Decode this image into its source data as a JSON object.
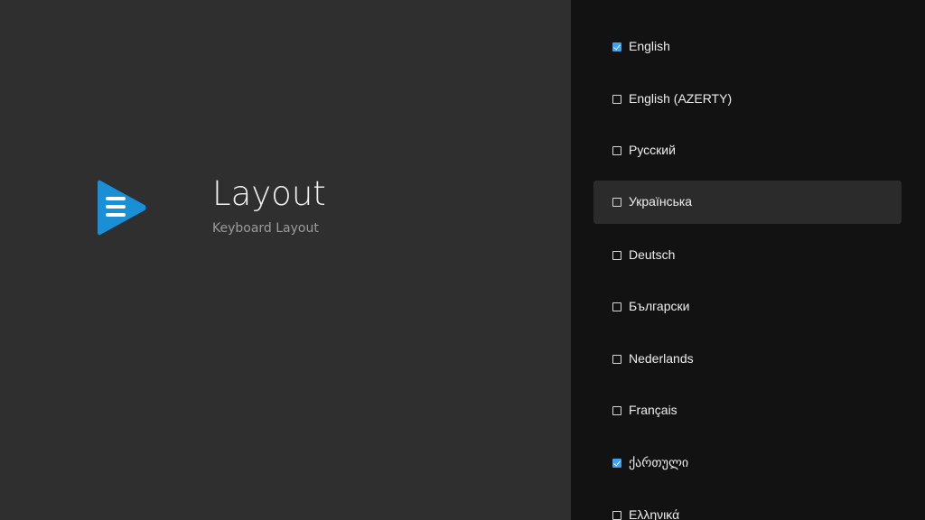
{
  "header": {
    "title": "Layout",
    "subtitle": "Keyboard Layout",
    "logo_icon": "app-logo-play-menu-icon"
  },
  "colors": {
    "left_background": "#2f2f2f",
    "right_background": "#121212",
    "focused_row": "#2b2b2b",
    "accent": "#3ea2ef",
    "logo_blue": "#1a8fd6"
  },
  "options": [
    {
      "label": "English",
      "checked": true,
      "focused": false
    },
    {
      "label": "English (AZERTY)",
      "checked": false,
      "focused": false
    },
    {
      "label": "Русский",
      "checked": false,
      "focused": false
    },
    {
      "label": "Українська",
      "checked": false,
      "focused": true
    },
    {
      "label": "Deutsch",
      "checked": false,
      "focused": false
    },
    {
      "label": "Български",
      "checked": false,
      "focused": false
    },
    {
      "label": "Nederlands",
      "checked": false,
      "focused": false
    },
    {
      "label": "Français",
      "checked": false,
      "focused": false
    },
    {
      "label": "ქართული",
      "checked": true,
      "focused": false
    },
    {
      "label": "Ελληνικά",
      "checked": false,
      "focused": false
    }
  ]
}
